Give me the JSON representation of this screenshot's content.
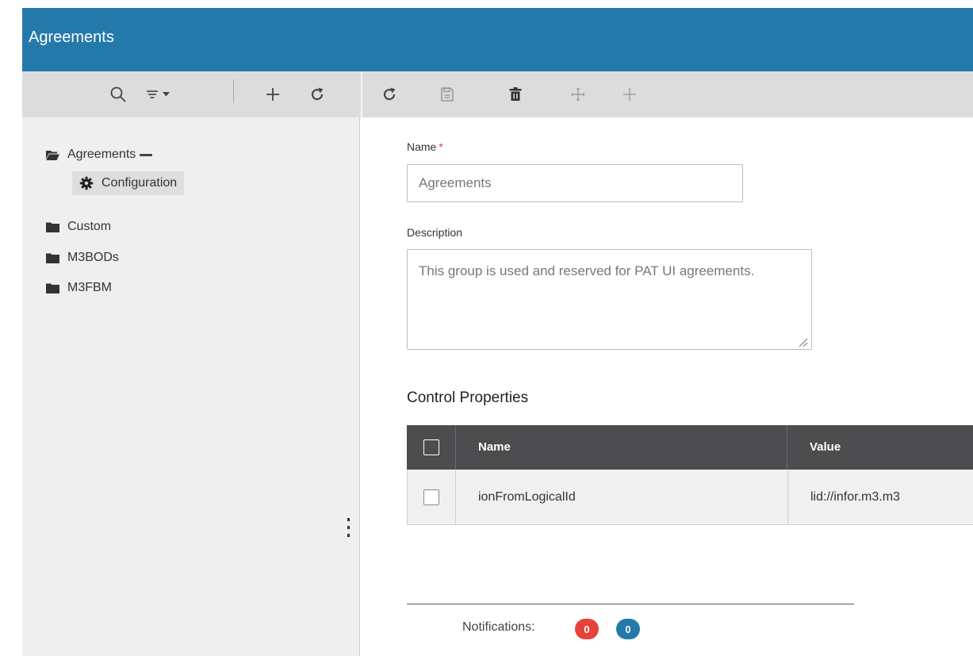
{
  "app": {
    "title": "Agreements",
    "header_color": "#2479ab"
  },
  "left_toolbar": {
    "icons": [
      "search-icon",
      "filter-icon",
      "add-icon",
      "refresh-icon"
    ]
  },
  "right_toolbar": {
    "icons": [
      "refresh-icon",
      "save-icon",
      "delete-icon",
      "move-icon",
      "add-icon"
    ]
  },
  "tree": {
    "root": {
      "label": "Agreements",
      "icon": "folder-open-icon"
    },
    "children": [
      {
        "label": "Configuration",
        "icon": "gear-icon",
        "selected": true
      }
    ],
    "folders": [
      {
        "label": "Custom",
        "icon": "folder-icon"
      },
      {
        "label": "M3BODs",
        "icon": "folder-icon"
      },
      {
        "label": "M3FBM",
        "icon": "folder-icon"
      }
    ]
  },
  "form": {
    "name_label": "Name",
    "required_mark": "*",
    "name_value": "Agreements",
    "description_label": "Description",
    "description_value": "This group is used and reserved for PAT UI agreements."
  },
  "control_properties": {
    "title": "Control Properties",
    "columns": [
      "Name",
      "Value"
    ],
    "rows": [
      {
        "name": "ionFromLogicalId",
        "value": "lid://infor.m3.m3"
      }
    ]
  },
  "notifications": {
    "label": "Notifications:",
    "error_count": "0",
    "info_count": "0",
    "error_color": "#e8403b",
    "info_color": "#2479ab"
  }
}
